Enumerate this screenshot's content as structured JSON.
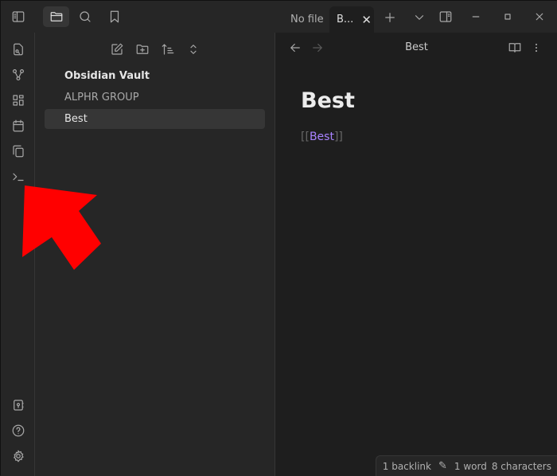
{
  "titlebar": {
    "tabs": [
      {
        "label": "No file"
      },
      {
        "label": "B..."
      }
    ]
  },
  "sidebar": {
    "vault_name": "Obsidian Vault",
    "items": [
      {
        "label": "ALPHR GROUP"
      },
      {
        "label": "Best"
      }
    ]
  },
  "main": {
    "header_title": "Best",
    "heading": "Best",
    "link_open": "[[",
    "link_text": "Best",
    "link_close": "]]"
  },
  "status": {
    "backlinks": "1 backlink",
    "words": "1 word",
    "characters": "8 characters"
  },
  "colors": {
    "accent": "#a882ff",
    "annotation_arrow": "#ff0000"
  }
}
